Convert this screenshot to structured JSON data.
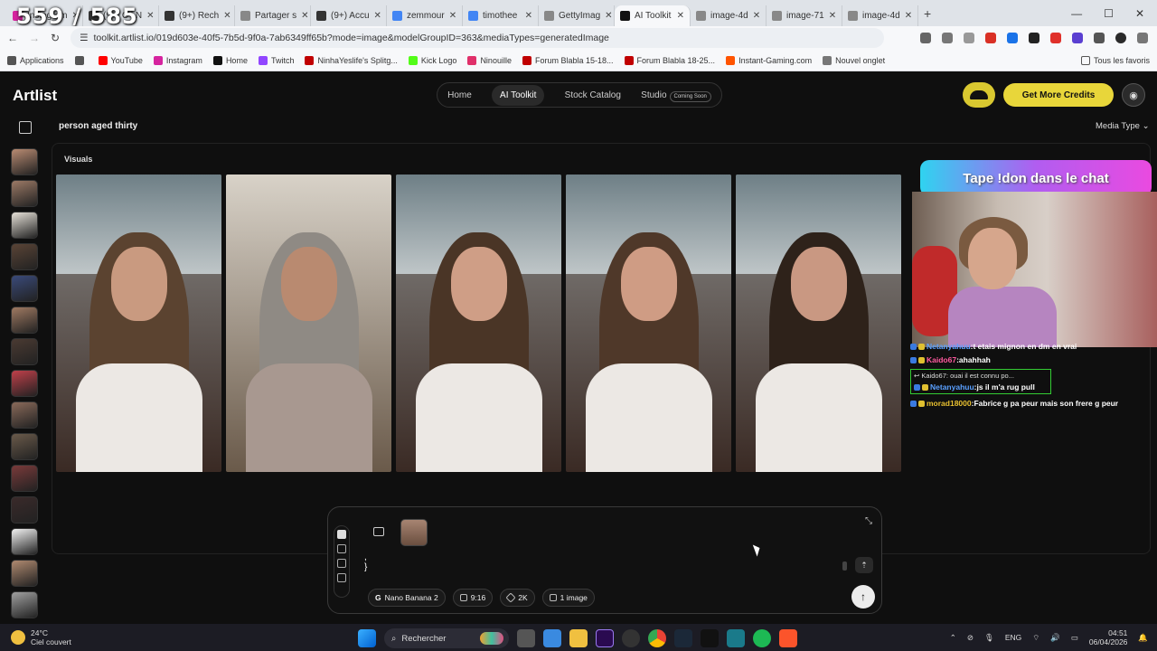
{
  "browser": {
    "tabs": [
      {
        "label": "Instagram",
        "color": "#d6249f",
        "icon": "instagram-icon"
      },
      {
        "label": "(9+) C l N",
        "color": "#333333",
        "icon": "threads-icon"
      },
      {
        "label": "(9+) Rech",
        "color": "#333333",
        "icon": "threads-icon"
      },
      {
        "label": "Partager s",
        "color": "#888888",
        "icon": "globe-icon"
      },
      {
        "label": "(9+) Accu",
        "color": "#333333",
        "icon": "threads-icon"
      },
      {
        "label": "zemmour",
        "color": "#4285f4",
        "icon": "google-icon"
      },
      {
        "label": "timothee",
        "color": "#4285f4",
        "icon": "google-icon"
      },
      {
        "label": "GettyImag",
        "color": "#888888",
        "icon": "globe-icon"
      },
      {
        "label": "AI Toolkit",
        "color": "#111111",
        "icon": "artlist-icon",
        "active": true
      },
      {
        "label": "image-4d",
        "color": "#888888",
        "icon": "globe-icon"
      },
      {
        "label": "image-71",
        "color": "#888888",
        "icon": "globe-icon"
      },
      {
        "label": "image-4d",
        "color": "#888888",
        "icon": "globe-icon"
      }
    ],
    "view_counter": "559 / 585",
    "url": "toolkit.artlist.io/019d603e-40f5-7b5d-9f0a-7ab6349ff65b?mode=image&modelGroupID=363&mediaTypes=generatedImage",
    "bookmarks": [
      {
        "label": "Applications",
        "color": "#555555"
      },
      {
        "label": "",
        "color": "#555555"
      },
      {
        "label": "YouTube",
        "color": "#ff0000"
      },
      {
        "label": "Instagram",
        "color": "#d6249f"
      },
      {
        "label": "Home",
        "color": "#111111"
      },
      {
        "label": "Twitch",
        "color": "#9146ff"
      },
      {
        "label": "NinhaYeslife's Splitg...",
        "color": "#c00000"
      },
      {
        "label": "Kick Logo",
        "color": "#53fc18"
      },
      {
        "label": "Ninouille",
        "color": "#e0306a"
      },
      {
        "label": "Forum Blabla 15-18...",
        "color": "#c00000"
      },
      {
        "label": "Forum Blabla 18-25...",
        "color": "#c00000"
      },
      {
        "label": "Instant-Gaming.com",
        "color": "#ff5400"
      },
      {
        "label": "Nouvel onglet",
        "color": "#777777"
      }
    ],
    "all_bookmarks": "Tous les favoris"
  },
  "app": {
    "logo": "Artlist",
    "nav": {
      "home": "Home",
      "ai_toolkit": "AI Toolkit",
      "stock_catalog": "Stock Catalog",
      "studio": "Studio",
      "coming_soon": "Coming Soon"
    },
    "get_credits": "Get More Credits",
    "query": "person aged thirty",
    "media_type": "Media Type",
    "section": "Visuals",
    "sidebar_thumbs": [
      "#b98b72",
      "#9c7a66",
      "#e6e1d8",
      "#5a4436",
      "#3a4a7a",
      "#a07a62",
      "#4a3a32",
      "#c0404a",
      "#8a6a5a",
      "#6a5a4a",
      "#7a3a3a",
      "#3a2a2a",
      "#f2f2f2",
      "#b08a70",
      "#a0a0a0"
    ],
    "photos": [
      {
        "hair": "#5b4330",
        "face": "#c99a80",
        "label": "young man"
      },
      {
        "hair": "#8f8a84",
        "face": "#b98a70",
        "label": "grey-haired woman"
      },
      {
        "hair": "#4a3526",
        "face": "#cf9e86",
        "label": "woman in car"
      },
      {
        "hair": "#4f3829",
        "face": "#cf9c84",
        "label": "woman in car"
      },
      {
        "hair": "#2e221a",
        "face": "#c99882",
        "label": "woman in car"
      }
    ],
    "composer": {
      "prompt_lines": [
        ",",
        "}"
      ],
      "model": "Nano Banana 2",
      "ratio": "9:16",
      "resolution": "2K",
      "count": "1 image"
    }
  },
  "overlay": {
    "donate": "Tape !don dans le chat",
    "chat": [
      {
        "user": "Netanyahuu",
        "text": ":t etais mignon en dm en vrai",
        "ucls": "u1"
      },
      {
        "user": "Kaido67",
        "text": ":ahahhah",
        "ucls": "u2"
      },
      {
        "reply_to": "Kaido67: ouai il est connu po...",
        "user": "Netanyahuu",
        "text": ":js il m'a rug pull",
        "ucls": "u1"
      },
      {
        "user": "morad18000",
        "text": ":Fabrice g pa peur mais son frere g peur",
        "ucls": "u3"
      }
    ]
  },
  "taskbar": {
    "temp": "24°C",
    "weather": "Ciel couvert",
    "search": "Rechercher",
    "lang": "ENG",
    "time": "04:51",
    "date": "06/04/2026"
  }
}
